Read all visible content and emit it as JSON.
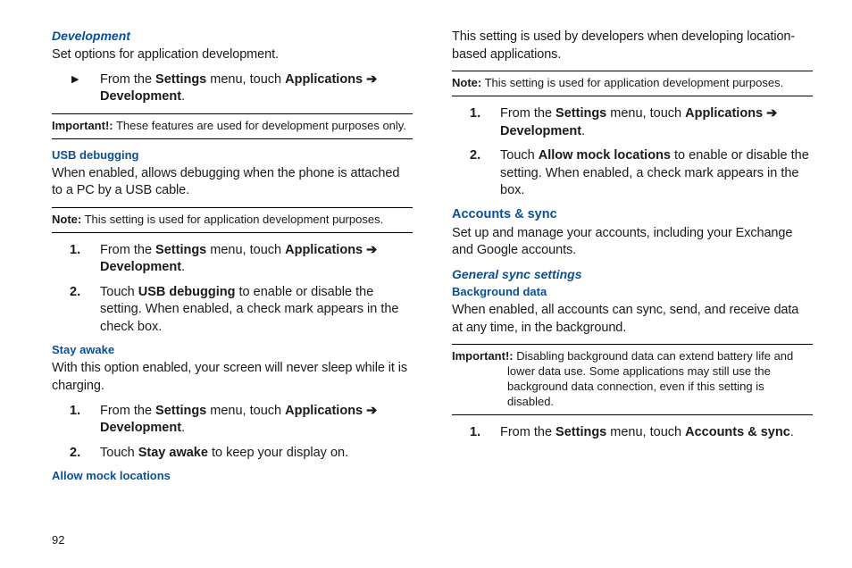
{
  "page_number": "92",
  "left": {
    "development": {
      "heading": "Development",
      "intro": "Set options for application development.",
      "nav_bullet": {
        "prefix": "From the ",
        "bold1": "Settings",
        "mid": " menu, touch ",
        "bold2": "Applications",
        "arrow": " ➔ ",
        "bold3": "Development",
        "suffix": "."
      },
      "important": {
        "label": "Important!:",
        "text": " These features are used for development purposes only."
      }
    },
    "usb": {
      "heading": "USB debugging",
      "intro": "When enabled, allows debugging when the phone is attached to a PC by a USB cable.",
      "note": {
        "label": "Note:",
        "text": " This setting is used for application development purposes."
      },
      "steps": [
        {
          "prefix": "From the ",
          "bold1": "Settings",
          "mid": " menu, touch ",
          "bold2": "Applications",
          "arrow": " ➔ ",
          "bold3": "Development",
          "suffix": "."
        },
        {
          "prefix": "Touch ",
          "bold1": "USB debugging",
          "suffix": " to enable or disable the setting. When enabled, a check mark appears in the check box."
        }
      ]
    },
    "stay": {
      "heading": "Stay awake",
      "intro": "With this option enabled, your screen will never sleep while it is charging.",
      "steps": [
        {
          "prefix": "From the ",
          "bold1": "Settings",
          "mid": " menu, touch ",
          "bold2": "Applications",
          "arrow": " ➔ ",
          "bold3": "Development",
          "suffix": "."
        },
        {
          "prefix": "Touch ",
          "bold1": "Stay awake",
          "suffix": " to keep your display on."
        }
      ]
    }
  },
  "right": {
    "mock": {
      "heading": "Allow mock locations",
      "intro": "This setting is used by developers when developing location-based applications.",
      "note": {
        "label": "Note:",
        "text": " This setting is used for application development purposes."
      },
      "steps": [
        {
          "prefix": "From the ",
          "bold1": "Settings",
          "mid": " menu, touch ",
          "bold2": "Applications",
          "arrow": " ➔ ",
          "bold3": "Development",
          "suffix": "."
        },
        {
          "prefix": "Touch ",
          "bold1": "Allow mock locations",
          "suffix": " to enable or disable the setting. When enabled, a check mark appears in the box."
        }
      ]
    },
    "accounts": {
      "heading": "Accounts & sync",
      "intro": "Set up and manage your accounts, including your Exchange and Google accounts."
    },
    "general": {
      "heading": "General sync settings"
    },
    "bgdata": {
      "heading": "Background data",
      "intro": "When enabled, all accounts can sync, send, and receive data at any time, in the background.",
      "important": {
        "label": "Important!:",
        "text": " Disabling background data can extend battery life and lower data use. Some applications may still use the background data connection, even if this setting is disabled."
      },
      "steps": [
        {
          "prefix": "From the ",
          "bold1": "Settings",
          "mid": " menu, touch ",
          "bold2": "Accounts & sync",
          "suffix": "."
        }
      ]
    }
  }
}
